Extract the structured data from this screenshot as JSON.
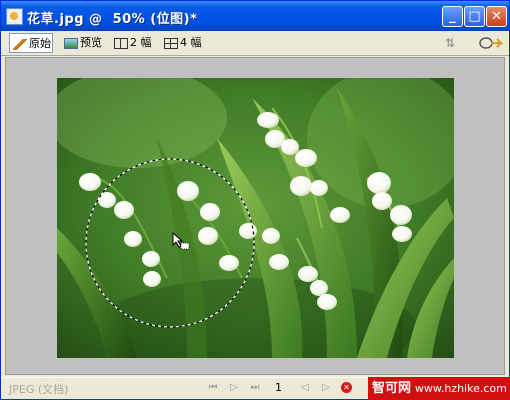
{
  "window": {
    "title": "花草.jpg @  50% (位图)*",
    "buttons": {
      "minimize": "_",
      "maximize": "□",
      "close": "✕"
    }
  },
  "toolbar": {
    "tabs": [
      {
        "label": "原始",
        "icon": "pencil-icon",
        "active": true
      },
      {
        "label": "预览",
        "icon": "preview-icon",
        "active": false
      },
      {
        "label": "2 幅",
        "icon": "two-up-icon",
        "active": false
      },
      {
        "label": "4 幅",
        "icon": "four-up-icon",
        "active": false
      }
    ],
    "right_icons": [
      "sort-arrows-icon",
      "zoom-pointer-icon"
    ]
  },
  "canvas": {
    "background": "#c0c0c0",
    "image": "lily of the valley flowers photo with a dashed circular marquee selection",
    "cursor_icon": "move-cursor-icon"
  },
  "status": {
    "format_text": "JPEG (文档)",
    "page_number": "1",
    "nav_icons": [
      "first-frame-icon",
      "play-icon",
      "last-frame-icon",
      "prev-frame-icon",
      "next-frame-icon",
      "stop-icon"
    ]
  },
  "watermark": {
    "name": "智可网",
    "url": "www.hzhike.com",
    "color": "#d01010"
  }
}
